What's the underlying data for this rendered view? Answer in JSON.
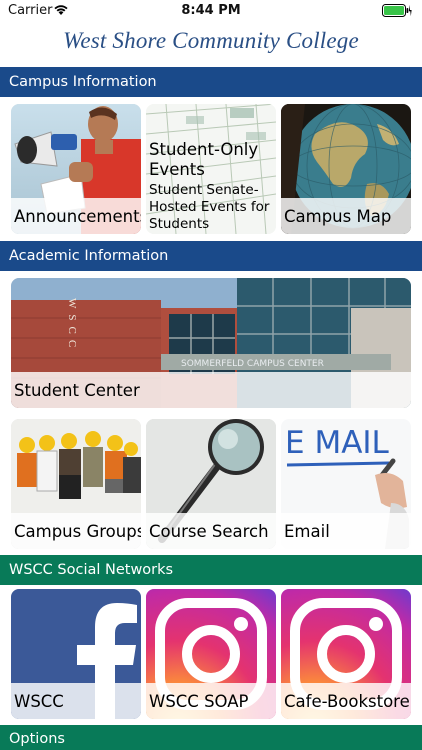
{
  "status_bar": {
    "carrier": "Carrier",
    "time": "8:44 PM",
    "battery_icon": "battery-charging-icon",
    "wifi_icon": "wifi-icon"
  },
  "header": {
    "title": "West Shore Community College"
  },
  "sections": {
    "campus": "Campus Information",
    "academic": "Academic Information",
    "social": "WSCC Social Networks",
    "options": "Options"
  },
  "tiles": {
    "announcements": "Announcements",
    "events_title": "Student-Only Events",
    "events_sub": "Student Senate-Hosted Events for Students",
    "campus_map": "Campus Map",
    "student_center": "Student Center",
    "campus_groups": "Campus Groups",
    "course_search": "Course Search",
    "email": "Email",
    "email_art_text": "E MAIL",
    "sign_letters": "WSCC",
    "building_sign": "SOMMERFELD CAMPUS CENTER",
    "facebook": "WSCC",
    "instagram_soap": "WSCC SOAP",
    "instagram_cafe": "Cafe-Bookstore"
  },
  "colors": {
    "header_title": "#2a4f85",
    "section_blue": "#1a4a8a",
    "section_green": "#087a58",
    "facebook_blue": "#3b5998"
  }
}
